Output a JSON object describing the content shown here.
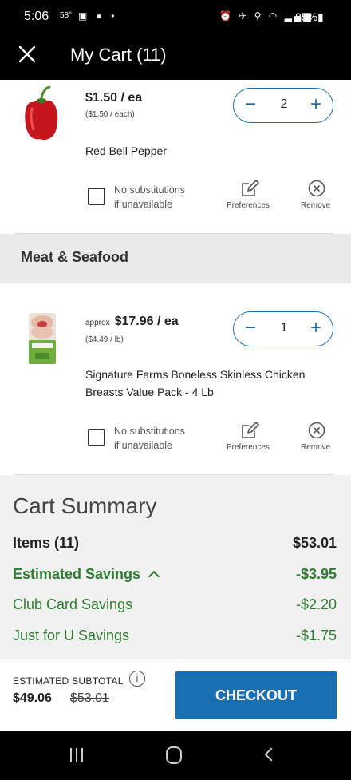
{
  "status_bar": {
    "time": "5:06",
    "temp": "58°",
    "left_icons": "▣ ● •",
    "right_icons": "⏰ ✈ ⚲ ◠ ▂▄▆",
    "battery": "85%▮"
  },
  "header": {
    "title": "My Cart (11)"
  },
  "items": [
    {
      "price": "$1.50 / ea",
      "unit_price": "($1.50 / each)",
      "quantity": "2",
      "name": "Red Bell Pepper",
      "no_sub_line1": "No substitutions",
      "no_sub_line2": "if unavailable",
      "preferences": "Preferences",
      "remove": "Remove"
    },
    {
      "approx": "approx",
      "price": "$17.96 / ea",
      "unit_price": "($4.49 / lb)",
      "quantity": "1",
      "name_line1": "Signature Farms Boneless Skinless Chicken",
      "name_line2": "Breasts Value Pack - 4 Lb",
      "no_sub_line1": "No substitutions",
      "no_sub_line2": "if unavailable",
      "preferences": "Preferences",
      "remove": "Remove"
    }
  ],
  "section": {
    "title": "Meat & Seafood"
  },
  "summary": {
    "title": "Cart Summary",
    "items_label": "Items (11)",
    "items_value": "$53.01",
    "savings_label": "Estimated Savings",
    "savings_value": "-$3.95",
    "club_label": "Club Card Savings",
    "club_value": "-$2.20",
    "jfu_label": "Just for U Savings",
    "jfu_value": "-$1.75"
  },
  "bottom": {
    "est_label": "ESTIMATED SUBTOTAL",
    "info": "i",
    "est_total": "$49.06",
    "est_original": "$53.01",
    "checkout": "CHECKOUT"
  },
  "colors": {
    "accent": "#1a6fb3",
    "savings_green": "#2e7d32",
    "summary_bg": "#f1f1f1"
  }
}
